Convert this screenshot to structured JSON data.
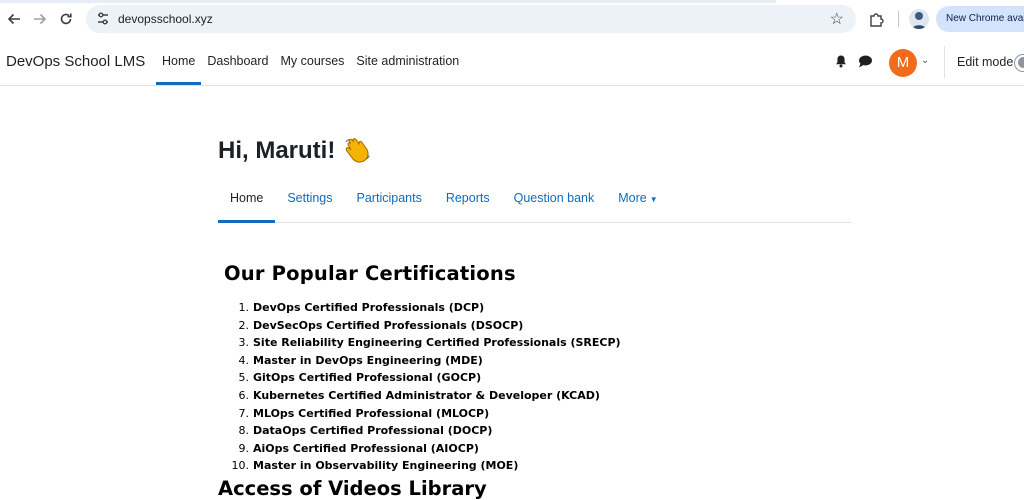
{
  "browser": {
    "url": "devopsschool.xyz",
    "update_label": "New Chrome available"
  },
  "navbar": {
    "brand": "DevOps School LMS",
    "items": [
      {
        "label": "Home",
        "active": true
      },
      {
        "label": "Dashboard",
        "active": false
      },
      {
        "label": "My courses",
        "active": false
      },
      {
        "label": "Site administration",
        "active": false
      }
    ],
    "avatar_initial": "M",
    "edit_mode_label": "Edit mode",
    "edit_mode_on": false
  },
  "main": {
    "greeting": "Hi, Maruti!",
    "tabs": [
      {
        "label": "Home",
        "active": true
      },
      {
        "label": "Settings",
        "active": false
      },
      {
        "label": "Participants",
        "active": false
      },
      {
        "label": "Reports",
        "active": false
      },
      {
        "label": "Question bank",
        "active": false
      },
      {
        "label": "More",
        "active": false
      }
    ],
    "certifications_heading": "Our Popular Certifications",
    "certifications": [
      "DevOps Certified Professionals (DCP)",
      "DevSecOps Certified Professionals (DSOCP)",
      "Site Reliability Engineering Certified Professionals (SRECP)",
      "Master in DevOps Engineering (MDE)",
      "GitOps Certified Professional (GOCP)",
      "Kubernetes Certified Administrator & Developer (KCAD)",
      "MLOps Certified Professional (MLOCP)",
      "DataOps Certified Professional (DOCP)",
      "AiOps Certified Professional (AIOCP)",
      "Master in Observability Engineering (MOE)"
    ],
    "videos_heading": "Access of Videos Library"
  }
}
